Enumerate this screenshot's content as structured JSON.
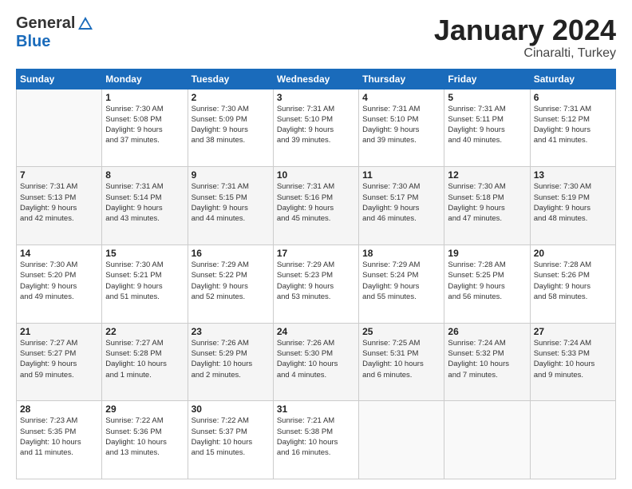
{
  "header": {
    "logo": {
      "general": "General",
      "blue": "Blue"
    },
    "title": "January 2024",
    "subtitle": "Cinaralti, Turkey"
  },
  "days_of_week": [
    "Sunday",
    "Monday",
    "Tuesday",
    "Wednesday",
    "Thursday",
    "Friday",
    "Saturday"
  ],
  "weeks": [
    [
      {
        "day": "",
        "info": ""
      },
      {
        "day": "1",
        "info": "Sunrise: 7:30 AM\nSunset: 5:08 PM\nDaylight: 9 hours\nand 37 minutes."
      },
      {
        "day": "2",
        "info": "Sunrise: 7:30 AM\nSunset: 5:09 PM\nDaylight: 9 hours\nand 38 minutes."
      },
      {
        "day": "3",
        "info": "Sunrise: 7:31 AM\nSunset: 5:10 PM\nDaylight: 9 hours\nand 39 minutes."
      },
      {
        "day": "4",
        "info": "Sunrise: 7:31 AM\nSunset: 5:10 PM\nDaylight: 9 hours\nand 39 minutes."
      },
      {
        "day": "5",
        "info": "Sunrise: 7:31 AM\nSunset: 5:11 PM\nDaylight: 9 hours\nand 40 minutes."
      },
      {
        "day": "6",
        "info": "Sunrise: 7:31 AM\nSunset: 5:12 PM\nDaylight: 9 hours\nand 41 minutes."
      }
    ],
    [
      {
        "day": "7",
        "info": "Sunrise: 7:31 AM\nSunset: 5:13 PM\nDaylight: 9 hours\nand 42 minutes."
      },
      {
        "day": "8",
        "info": "Sunrise: 7:31 AM\nSunset: 5:14 PM\nDaylight: 9 hours\nand 43 minutes."
      },
      {
        "day": "9",
        "info": "Sunrise: 7:31 AM\nSunset: 5:15 PM\nDaylight: 9 hours\nand 44 minutes."
      },
      {
        "day": "10",
        "info": "Sunrise: 7:31 AM\nSunset: 5:16 PM\nDaylight: 9 hours\nand 45 minutes."
      },
      {
        "day": "11",
        "info": "Sunrise: 7:30 AM\nSunset: 5:17 PM\nDaylight: 9 hours\nand 46 minutes."
      },
      {
        "day": "12",
        "info": "Sunrise: 7:30 AM\nSunset: 5:18 PM\nDaylight: 9 hours\nand 47 minutes."
      },
      {
        "day": "13",
        "info": "Sunrise: 7:30 AM\nSunset: 5:19 PM\nDaylight: 9 hours\nand 48 minutes."
      }
    ],
    [
      {
        "day": "14",
        "info": "Sunrise: 7:30 AM\nSunset: 5:20 PM\nDaylight: 9 hours\nand 49 minutes."
      },
      {
        "day": "15",
        "info": "Sunrise: 7:30 AM\nSunset: 5:21 PM\nDaylight: 9 hours\nand 51 minutes."
      },
      {
        "day": "16",
        "info": "Sunrise: 7:29 AM\nSunset: 5:22 PM\nDaylight: 9 hours\nand 52 minutes."
      },
      {
        "day": "17",
        "info": "Sunrise: 7:29 AM\nSunset: 5:23 PM\nDaylight: 9 hours\nand 53 minutes."
      },
      {
        "day": "18",
        "info": "Sunrise: 7:29 AM\nSunset: 5:24 PM\nDaylight: 9 hours\nand 55 minutes."
      },
      {
        "day": "19",
        "info": "Sunrise: 7:28 AM\nSunset: 5:25 PM\nDaylight: 9 hours\nand 56 minutes."
      },
      {
        "day": "20",
        "info": "Sunrise: 7:28 AM\nSunset: 5:26 PM\nDaylight: 9 hours\nand 58 minutes."
      }
    ],
    [
      {
        "day": "21",
        "info": "Sunrise: 7:27 AM\nSunset: 5:27 PM\nDaylight: 9 hours\nand 59 minutes."
      },
      {
        "day": "22",
        "info": "Sunrise: 7:27 AM\nSunset: 5:28 PM\nDaylight: 10 hours\nand 1 minute."
      },
      {
        "day": "23",
        "info": "Sunrise: 7:26 AM\nSunset: 5:29 PM\nDaylight: 10 hours\nand 2 minutes."
      },
      {
        "day": "24",
        "info": "Sunrise: 7:26 AM\nSunset: 5:30 PM\nDaylight: 10 hours\nand 4 minutes."
      },
      {
        "day": "25",
        "info": "Sunrise: 7:25 AM\nSunset: 5:31 PM\nDaylight: 10 hours\nand 6 minutes."
      },
      {
        "day": "26",
        "info": "Sunrise: 7:24 AM\nSunset: 5:32 PM\nDaylight: 10 hours\nand 7 minutes."
      },
      {
        "day": "27",
        "info": "Sunrise: 7:24 AM\nSunset: 5:33 PM\nDaylight: 10 hours\nand 9 minutes."
      }
    ],
    [
      {
        "day": "28",
        "info": "Sunrise: 7:23 AM\nSunset: 5:35 PM\nDaylight: 10 hours\nand 11 minutes."
      },
      {
        "day": "29",
        "info": "Sunrise: 7:22 AM\nSunset: 5:36 PM\nDaylight: 10 hours\nand 13 minutes."
      },
      {
        "day": "30",
        "info": "Sunrise: 7:22 AM\nSunset: 5:37 PM\nDaylight: 10 hours\nand 15 minutes."
      },
      {
        "day": "31",
        "info": "Sunrise: 7:21 AM\nSunset: 5:38 PM\nDaylight: 10 hours\nand 16 minutes."
      },
      {
        "day": "",
        "info": ""
      },
      {
        "day": "",
        "info": ""
      },
      {
        "day": "",
        "info": ""
      }
    ]
  ]
}
